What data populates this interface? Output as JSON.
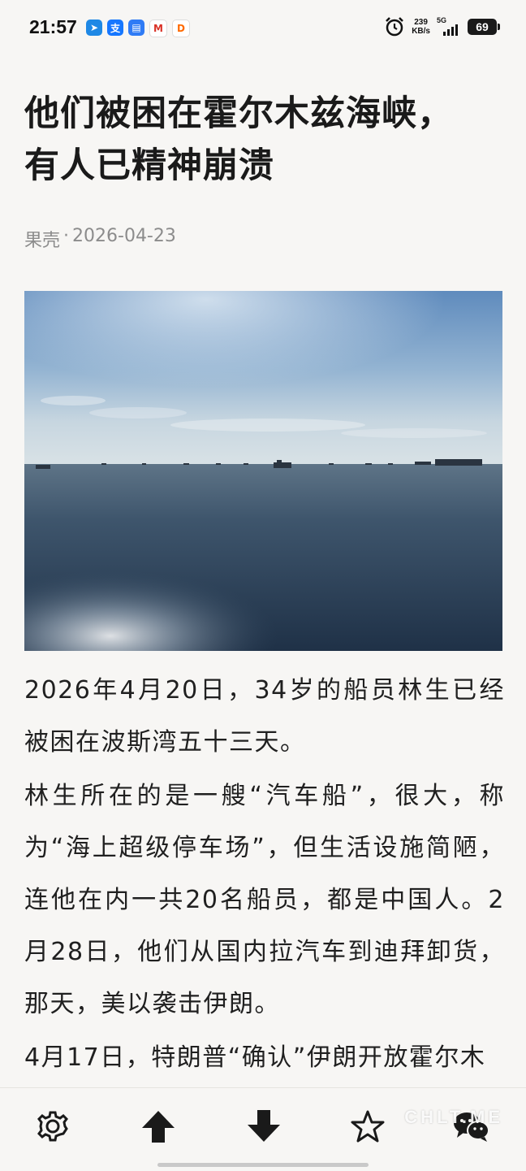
{
  "status_bar": {
    "time": "21:57",
    "net_speed_value": "239",
    "net_speed_unit": "KB/s",
    "network": "5G",
    "battery": "69",
    "notification_icons": [
      "telegram-icon",
      "alipay-icon",
      "chat-icon",
      "gmail-icon",
      "didi-icon"
    ]
  },
  "article": {
    "title": "他们被困在霍尔木兹海峡，有人已精神崩溃",
    "source": "果壳",
    "separator": "·",
    "date": "2026-04-23",
    "paragraphs": [
      "2026年4月20日，34岁的船员林生已经被困在波斯湾五十三天。",
      "林生所在的是一艘“汽车船”，很大，称为“海上超级停车场”，但生活设施简陋，连他在内一共20名船员，都是中国人。2月28日，他们从国内拉汽车到迪拜卸货，那天，美以袭击伊朗。",
      "4月17日，特朗普“确认”伊朗开放霍尔木"
    ]
  },
  "toolbar": {
    "items": [
      "settings-icon",
      "scroll-up-icon",
      "scroll-down-icon",
      "star-icon",
      "wechat-icon"
    ]
  },
  "watermark": "CHLT.ME",
  "colors": {
    "background": "#f7f6f4",
    "title": "#1a1a1a",
    "meta": "#8c8c8c"
  }
}
